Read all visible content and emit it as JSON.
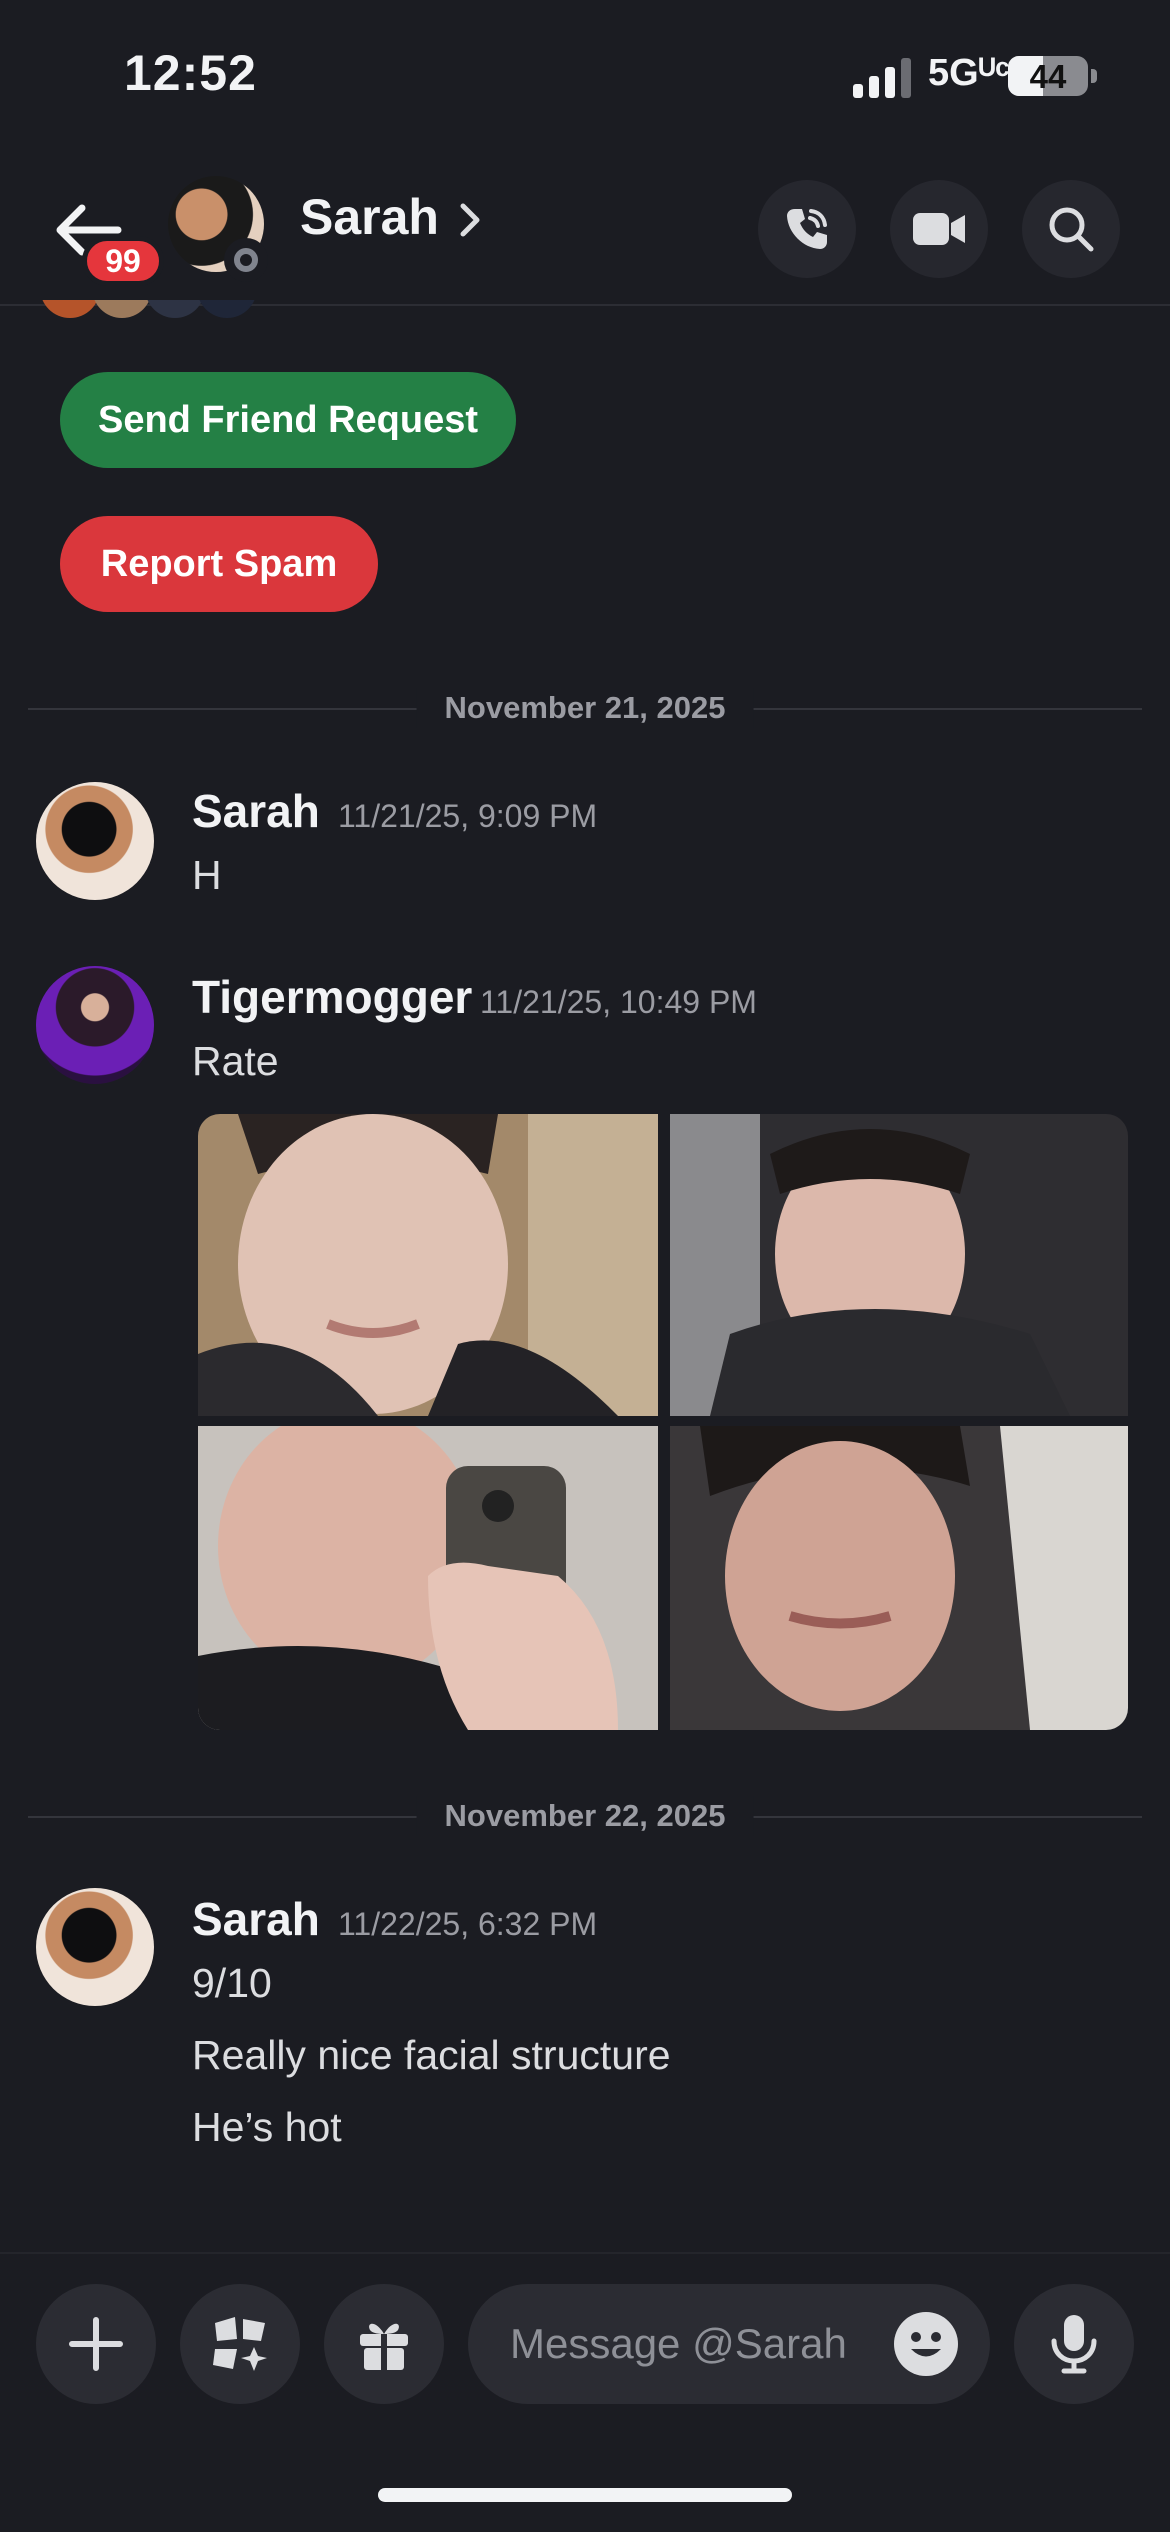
{
  "status_bar": {
    "time": "12:52",
    "network": "5Gᵁᶜ",
    "battery": "44",
    "battery_level": 0.44
  },
  "header": {
    "unread_badge": "99",
    "contact_name": "Sarah",
    "icons": [
      "back-arrow-icon",
      "phone-call-icon",
      "video-camera-icon",
      "search-icon"
    ]
  },
  "actions": {
    "friend_request": "Send Friend Request",
    "report_spam": "Report Spam"
  },
  "dividers": [
    "November 21, 2025",
    "November 22, 2025"
  ],
  "messages": [
    {
      "author": "Sarah",
      "time": "11/21/25, 9:09 PM",
      "lines": [
        "H"
      ]
    },
    {
      "author": "Tigermogger",
      "time": "11/21/25, 10:49 PM",
      "lines": [
        "Rate"
      ]
    },
    {
      "author": "Sarah",
      "time": "11/22/25, 6:32 PM",
      "lines": [
        "9/10",
        "Really nice facial structure",
        "He’s hot"
      ]
    }
  ],
  "attachments": {
    "count": 4
  },
  "composer": {
    "placeholder": "Message @Sarah",
    "icons": [
      "plus-icon",
      "apps-icon",
      "gift-icon",
      "emoji-icon",
      "microphone-icon"
    ]
  },
  "colors": {
    "background": "#1b1c22",
    "friend_button": "#248045",
    "spam_button": "#da373c",
    "badge": "#e5363c"
  }
}
